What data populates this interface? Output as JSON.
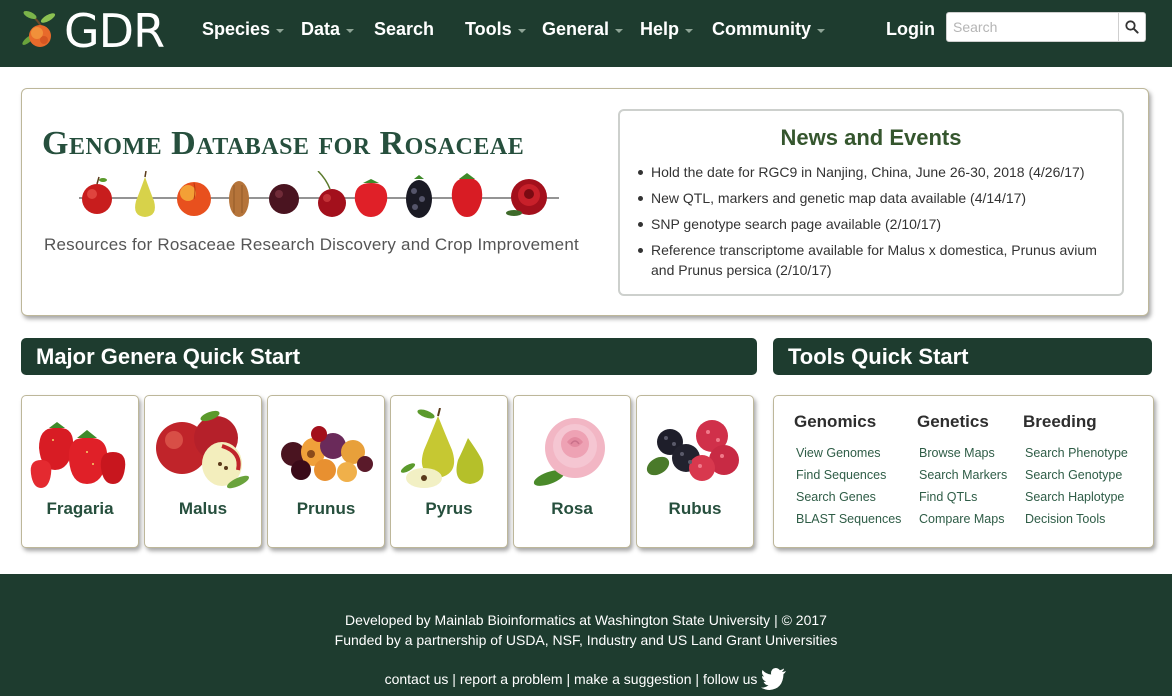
{
  "nav": {
    "logo_text": "GDR",
    "items": [
      {
        "label": "Species",
        "dropdown": true
      },
      {
        "label": "Data",
        "dropdown": true
      },
      {
        "label": "Search",
        "dropdown": false
      },
      {
        "label": "Tools",
        "dropdown": true
      },
      {
        "label": "General",
        "dropdown": true
      },
      {
        "label": "Help",
        "dropdown": true
      },
      {
        "label": "Community",
        "dropdown": true
      }
    ],
    "login": "Login",
    "search_placeholder": "Search"
  },
  "hero": {
    "title": "Genome Database for Rosaceae",
    "tagline": "Resources for Rosaceae Research Discovery and Crop Improvement",
    "fruits": [
      "apple",
      "pear",
      "peach",
      "almond",
      "plum",
      "cherry",
      "strawberry",
      "blackberry",
      "strawberry",
      "rose"
    ]
  },
  "news": {
    "title": "News and Events",
    "items": [
      "Hold the date for RGC9 in Nanjing, China, June 26-30, 2018 (4/26/17)",
      "New QTL, markers and genetic map data available (4/14/17)",
      "SNP genotype search page available (2/10/17)",
      "Reference transcriptome available for Malus x domestica, Prunus avium and Prunus persica (2/10/17)"
    ]
  },
  "genera": {
    "header": "Major Genera Quick Start",
    "items": [
      {
        "label": "Fragaria",
        "icon": "strawberry-icon"
      },
      {
        "label": "Malus",
        "icon": "apple-icon"
      },
      {
        "label": "Prunus",
        "icon": "stone-fruit-icon"
      },
      {
        "label": "Pyrus",
        "icon": "pear-icon"
      },
      {
        "label": "Rosa",
        "icon": "rose-icon"
      },
      {
        "label": "Rubus",
        "icon": "raspberry-icon"
      }
    ]
  },
  "tools": {
    "header": "Tools Quick Start",
    "columns": [
      {
        "title": "Genomics",
        "links": [
          "View Genomes",
          "Find Sequences",
          "Search Genes",
          "BLAST Sequences"
        ]
      },
      {
        "title": "Genetics",
        "links": [
          "Browse Maps",
          "Search Markers",
          "Find QTLs",
          "Compare Maps"
        ]
      },
      {
        "title": "Breeding",
        "links": [
          "Search Phenotype",
          "Search Genotype",
          "Search Haplotype",
          "Decision Tools"
        ]
      }
    ]
  },
  "footer": {
    "line1": "Developed by Mainlab Bioinformatics at Washington State University | © 2017",
    "line2": "Funded by a partnership of  USDA, NSF, Industry and US Land Grant Universities",
    "links": [
      "contact us",
      "report a problem",
      "make a suggestion",
      "follow us"
    ],
    "separator": " | "
  },
  "colors": {
    "brand_dark_green": "#1e3c2f",
    "title_green": "#264f3d",
    "news_title_green": "#35562e",
    "link_green": "#2f5d47"
  }
}
